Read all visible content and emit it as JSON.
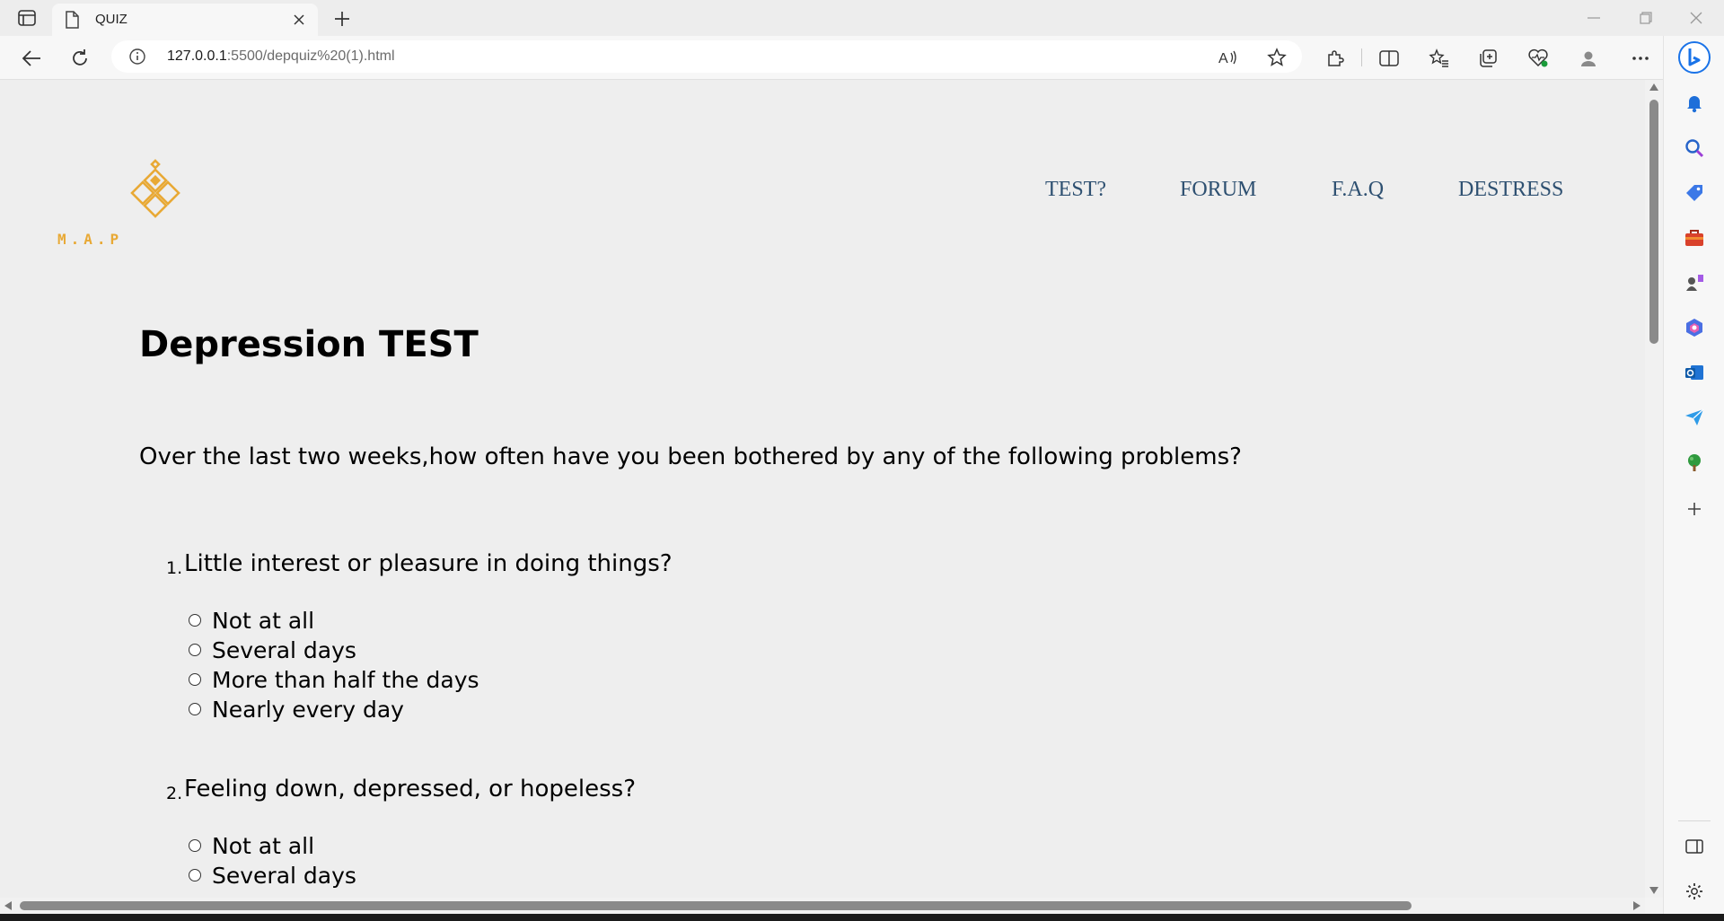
{
  "browser": {
    "tab_title": "QUIZ",
    "url_host": "127.0.0.1",
    "url_rest": ":5500/depquiz%20(1).html"
  },
  "page": {
    "logo_text": "M.A.P",
    "nav": [
      "TEST?",
      "FORUM",
      "F.A.Q",
      "DESTRESS"
    ],
    "title": "Depression TEST",
    "intro": "Over the last two weeks,how often have you been bothered by any of the following problems?",
    "questions": [
      {
        "number": "1.",
        "text": "Little interest or pleasure in doing things?",
        "options": [
          "Not at all",
          "Several days",
          "More than half the days",
          "Nearly every day"
        ]
      },
      {
        "number": "2.",
        "text": "Feeling down, depressed, or hopeless?",
        "options": [
          "Not at all",
          "Several days"
        ]
      }
    ]
  },
  "colors": {
    "logo": "#e8a935",
    "nav": "#2e5071",
    "page_bg": "#eeeeee"
  }
}
